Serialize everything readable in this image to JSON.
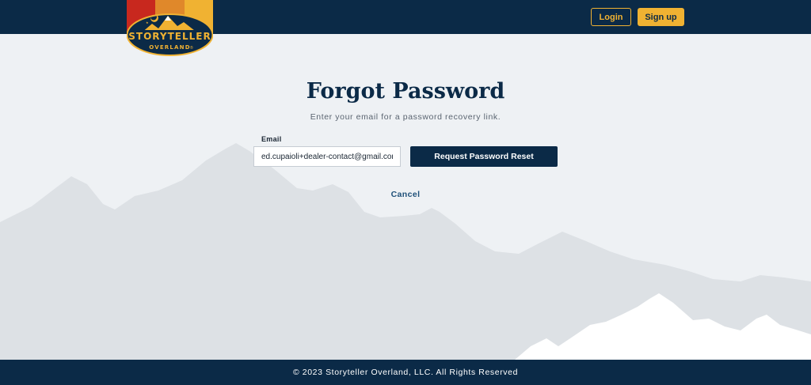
{
  "brand": {
    "logo_line1": "STORYTELLER",
    "logo_line2": "OVERLAND",
    "logo_mark": "®",
    "colors": {
      "navy": "#0b2a47",
      "gold": "#f0b232",
      "red": "#c8281e",
      "orange": "#e0882a"
    }
  },
  "header": {
    "login_label": "Login",
    "signup_label": "Sign up"
  },
  "form": {
    "title": "Forgot Password",
    "subtitle": "Enter your email for a password recovery link.",
    "email_label": "Email",
    "email_value": "ed.cupaioli+dealer-contact@gmail.com",
    "submit_label": "Request Password Reset",
    "cancel_label": "Cancel"
  },
  "footer": {
    "copyright": "© 2023 Storyteller Overland, LLC. All Rights Reserved"
  },
  "icons": {
    "logo": "storyteller-overland-logo",
    "background": "mountain-silhouette"
  }
}
